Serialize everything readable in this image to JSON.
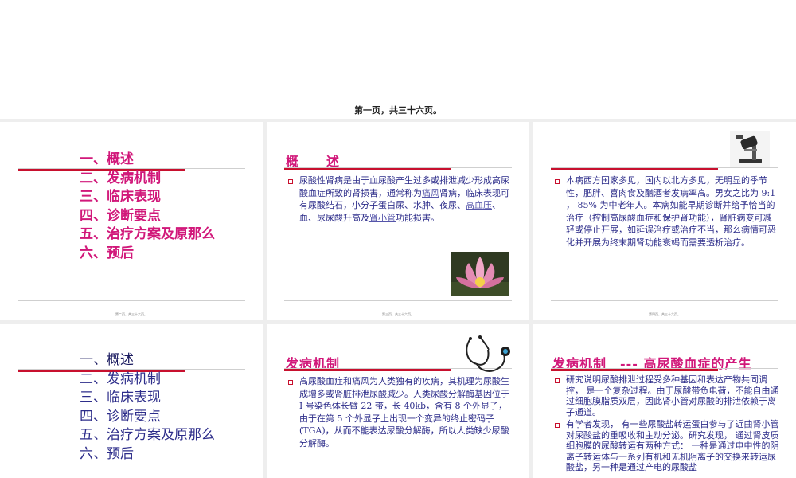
{
  "top_caption": "第一页，共三十六页。",
  "toc_items": [
    "一、概述",
    "二、发病机制",
    "三、临床表现",
    "四、诊断要点",
    "五、治疗方案及原那么",
    "六、预后"
  ],
  "slide1": {
    "footer": "第二页，共三十六页。"
  },
  "slide2": {
    "title": "概　　述",
    "p_a": "尿酸性肾病是由于血尿酸产生过多或排泄减少形成高尿酸血症所致的肾损害，通常称为",
    "link1": "痛风",
    "p_b": "肾病，临床表现可有尿酸结石，小分子蛋白尿、水肿、夜尿、",
    "link2": "高血压",
    "p_c": "、血、尿尿酸升高及",
    "link3": "肾小管",
    "p_d": "功能损害。",
    "image_alt": "pink-lotus-flower",
    "footer": "第三页，共三十六页。"
  },
  "slide3": {
    "text": "本病西方国家多见，国内以北方多见，无明显的季节性，肥胖、喜肉食及酗酒者发病率高。男女之比为 9:1 ， 85% 为中老年人。本病如能早期诊断并给予恰当的治疗（控制高尿酸血症和保护肾功能），肾脏病变可减轻或停止开展，如延误治疗或治疗不当，那么病情可恶化并开展为终末期肾功能衰竭而需要透析治疗。",
    "image_alt": "microscope",
    "footer": "第四页，共三十六页。"
  },
  "slide4": {
    "items": [
      "一、概述",
      "二、发病机制",
      "三、临床表现",
      "四、诊断要点",
      "五、治疗方案及原那么",
      "六、预后"
    ]
  },
  "slide5": {
    "title": "发病机制",
    "text": "高尿酸血症和痛风为人类独有的疾病，其机理为尿酸生成增多或肾脏排泄尿酸减少。人类尿酸分解酶基因位于 I 号染色体长臂 22 带，长 40kb，含有 8 个外显子，由于在第 5 个外显子上出现一个变异的终止密码子 (TGA)，从而不能表达尿酸分解酶，所以人类缺少尿酸分解酶。",
    "image_alt": "stethoscope"
  },
  "slide6": {
    "title": "发病机制　--- 高尿酸血症的产生",
    "p1": "研究说明尿酸排泄过程受多种基因和表达产物共同调控， 是一个复杂过程。由于尿酸带负电荷，不能自由通过细胞膜脂质双层，因此肾小管对尿酸的排泄依赖于离子通道。",
    "p2": "有学者发现， 有一些尿酸盐转运蛋白参与了近曲肾小管对尿酸盐的重吸收和主动分泌。研究发现， 通过肾皮质细胞膜的尿酸转运有两种方式： 一种是通过电中性的阴离子转运体与一系列有机和无机阴离子的交换来转运尿酸盐，另一种是通过产电的尿酸盐"
  }
}
